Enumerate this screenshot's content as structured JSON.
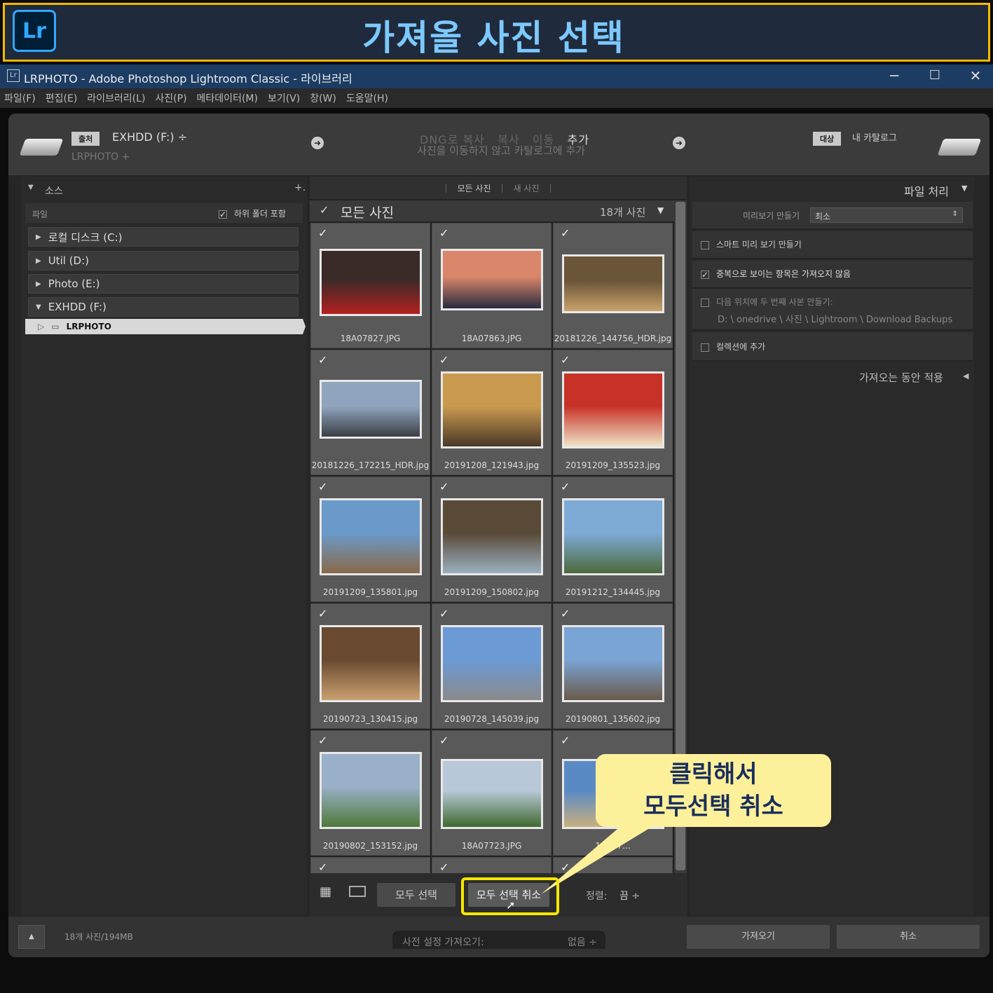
{
  "banner": {
    "logo": "Lr",
    "title": "가져올 사진 선택"
  },
  "window": {
    "icon": "Lr",
    "title": "LRPHOTO - Adobe Photoshop Lightroom Classic - 라이브러리",
    "min": "─",
    "max": "☐",
    "close": "✕"
  },
  "menu": [
    "파일(F)",
    "편집(E)",
    "라이브러리(L)",
    "사진(P)",
    "메타데이터(M)",
    "보기(V)",
    "창(W)",
    "도움말(H)"
  ],
  "source": {
    "tag": "출처",
    "drive": "EXHDD (F:) ÷",
    "sub": "LRPHOTO +"
  },
  "modes": {
    "items": [
      "DNG로 복사",
      "복사",
      "이동",
      "추가"
    ],
    "active": "추가",
    "desc": "사진을 이동하지 않고 카탈로그에 추가"
  },
  "dest": {
    "tag": "대상",
    "label": "내 카탈로그"
  },
  "left": {
    "title": "소스",
    "plus": "+.",
    "file_label": "파일",
    "subfolders": "하위 폴더 포함",
    "volumes": [
      {
        "name": "로컬 디스크 (C:)",
        "open": false
      },
      {
        "name": "Util (D:)",
        "open": false
      },
      {
        "name": "Photo (E:)",
        "open": false
      },
      {
        "name": "EXHDD (F:)",
        "open": true
      }
    ],
    "folder": "LRPHOTO"
  },
  "center": {
    "tabs": [
      "모든 사진",
      "새 사진"
    ],
    "header": "모든 사진",
    "count": "18개 사진",
    "photos": [
      {
        "name": "18A07827.JPG",
        "c1": "#3a2a28",
        "c2": "#b32020"
      },
      {
        "name": "18A07863.JPG",
        "c1": "#d9866a",
        "c2": "#2a2a40"
      },
      {
        "name": "20181226_144756_HDR.jpg",
        "c1": "#6b5538",
        "c2": "#c9a36b"
      },
      {
        "name": "20181226_172215_HDR.jpg",
        "c1": "#8fa4bd",
        "c2": "#3a3f45"
      },
      {
        "name": "20191208_121943.jpg",
        "c1": "#c99a4e",
        "c2": "#4a3828"
      },
      {
        "name": "20191209_135523.jpg",
        "c1": "#c73228",
        "c2": "#f0e4c8"
      },
      {
        "name": "20191209_135801.jpg",
        "c1": "#6a9ac9",
        "c2": "#8a6a4a"
      },
      {
        "name": "20191209_150802.jpg",
        "c1": "#5a4a38",
        "c2": "#9ab0c0"
      },
      {
        "name": "20191212_134445.jpg",
        "c1": "#7eaad6",
        "c2": "#4d6a3c"
      },
      {
        "name": "20190723_130415.jpg",
        "c1": "#6a4a30",
        "c2": "#c9a070"
      },
      {
        "name": "20190728_145039.jpg",
        "c1": "#6b9ad4",
        "c2": "#8a8a8a"
      },
      {
        "name": "20190801_135602.jpg",
        "c1": "#7aa4d4",
        "c2": "#6a5a4a"
      },
      {
        "name": "20190802_153152.jpg",
        "c1": "#9ab0c8",
        "c2": "#4f7a3a"
      },
      {
        "name": "18A07723.JPG",
        "c1": "#b8c8d8",
        "c2": "#3f6a30"
      },
      {
        "name": "18A07...",
        "c1": "#5a8ac4",
        "c2": "#c8b080"
      }
    ],
    "select_all": "모두 선택",
    "deselect_all": "모두 선택 취소",
    "sort_label": "정렬:",
    "sort_value": "끔 ÷"
  },
  "right": {
    "title": "파일 처리",
    "preview_label": "미리보기 만들기",
    "preview_value": "최소",
    "smart": "스마트 미리 보기 만들기",
    "dupes": "중복으로 보이는 항목은 가져오지 않음",
    "second_copy": "다음 위치에 두 번째 사본 만들기:",
    "path": "D: \\ onedrive \\ 사진 \\ Lightroom \\ Download Backups",
    "collection": "컬렉션에 추가",
    "apply": "가져오는 동안 적용"
  },
  "status": {
    "count": "18개 사진/194MB",
    "preset_label": "사전 설정 가져오기:",
    "preset_value": "없음 ÷",
    "import": "가져오기",
    "cancel": "취소"
  },
  "callout": {
    "line1": "클릭해서",
    "line2": "모두선택 취소"
  },
  "colors": {
    "accent": "#f5e600",
    "banner_border": "#f5b800",
    "callout_bg": "#fdf09a"
  }
}
